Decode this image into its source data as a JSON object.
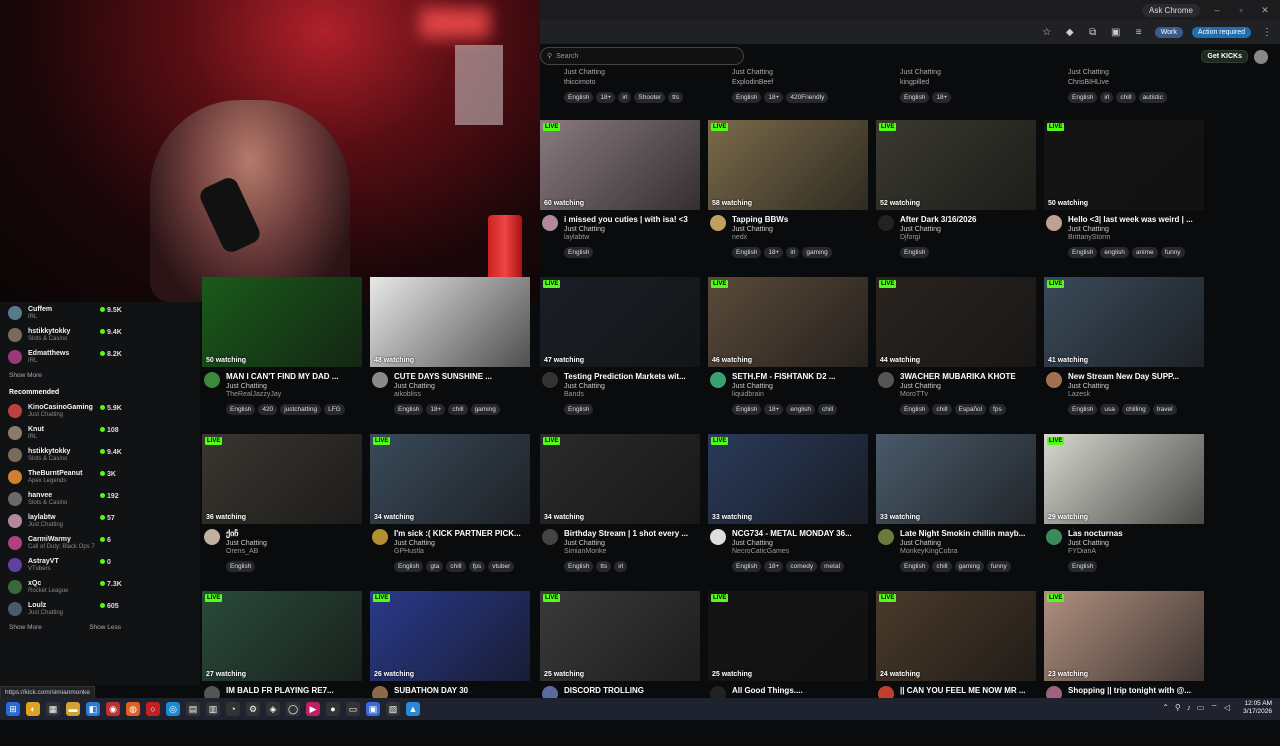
{
  "browser": {
    "ask_chrome": "Ask Chrome",
    "work_label": "Work",
    "action_label": "Action required",
    "search_placeholder": "Search",
    "get_kicks": "Get KICKs",
    "status_url": "https://kick.com/simianmonke"
  },
  "sidebar": {
    "following": [
      {
        "name": "Cuffem",
        "category": "IRL",
        "viewers": "9.5K",
        "color": "#5a7a8a"
      },
      {
        "name": "hstikkytokky",
        "category": "Slots & Casino",
        "viewers": "9.4K",
        "color": "#7a6a5a"
      },
      {
        "name": "Edmatthews",
        "category": "IRL",
        "viewers": "8.2K",
        "color": "#9a3a7a"
      }
    ],
    "show_more_1": "Show More",
    "recommended_title": "Recommended",
    "recommended": [
      {
        "name": "KinoCasinoGaming",
        "category": "Just Chatting",
        "viewers": "5.9K",
        "color": "#c04040"
      },
      {
        "name": "Knut",
        "category": "IRL",
        "viewers": "108",
        "color": "#8a7a6a"
      },
      {
        "name": "hstikkytokky",
        "category": "Slots & Casino",
        "viewers": "9.4K",
        "color": "#7a6a5a"
      },
      {
        "name": "TheBurntPeanut",
        "category": "Apex Legends",
        "viewers": "3K",
        "color": "#d08030"
      },
      {
        "name": "hanvee",
        "category": "Slots & Casino",
        "viewers": "192",
        "color": "#6a6a6a"
      },
      {
        "name": "laylabtw",
        "category": "Just Chatting",
        "viewers": "57",
        "color": "#b08a9a"
      },
      {
        "name": "CarmiWarmy",
        "category": "Call of Duty: Black Ops 7",
        "viewers": "6",
        "color": "#b04080"
      },
      {
        "name": "AstrayVT",
        "category": "VTubers",
        "viewers": "0",
        "color": "#6040a0"
      },
      {
        "name": "xQc",
        "category": "Rocket League",
        "viewers": "7.3K",
        "color": "#3a6a3a"
      },
      {
        "name": "Loulz",
        "category": "Just Chatting",
        "viewers": "605",
        "color": "#4a5a6a"
      }
    ],
    "show_more_2": "Show More",
    "show_less": "Show Less"
  },
  "top_row": [
    {
      "category": "Just Chatting",
      "streamer": "thiccimoto",
      "tags": [
        "English",
        "18+",
        "irl",
        "Shooter",
        "tts"
      ]
    },
    {
      "category": "Just Chatting",
      "streamer": "ExplodinBeef",
      "tags": [
        "English",
        "18+",
        "420Friendly"
      ]
    },
    {
      "category": "Just Chatting",
      "streamer": "kingpilled",
      "tags": [
        "English",
        "18+"
      ]
    },
    {
      "category": "Just Chatting",
      "streamer": "ChrisBIHLive",
      "tags": [
        "English",
        "irl",
        "chill",
        "autistic"
      ]
    }
  ],
  "cards": [
    {
      "live": "LIVE",
      "watching": "60 watching",
      "title": "i missed you cuties | with isa! <3",
      "category": "Just Chatting",
      "streamer": "laylabtw",
      "tags": [
        "English"
      ],
      "thumb": "#8a7a80",
      "avatar": "#b08a9a"
    },
    {
      "live": "LIVE",
      "watching": "58 watching",
      "title": "Tapping BBWs",
      "category": "Just Chatting",
      "streamer": "nedx",
      "tags": [
        "English",
        "18+",
        "irl",
        "gaming"
      ],
      "thumb": "#7a6a4a",
      "avatar": "#c0a060"
    },
    {
      "live": "LIVE",
      "watching": "52 watching",
      "title": "After Dark 3/16/2026",
      "category": "Just Chatting",
      "streamer": "Djforgi",
      "tags": [
        "English"
      ],
      "thumb": "#3a3a30",
      "avatar": "#222"
    },
    {
      "live": "LIVE",
      "watching": "50 watching",
      "title": "Hello <3| last week was weird | ...",
      "category": "Just Chatting",
      "streamer": "BrittanyStorm",
      "tags": [
        "English",
        "english",
        "anime",
        "funny"
      ],
      "thumb": "#141414",
      "avatar": "#c0a090"
    },
    {
      "live": "",
      "watching": "50 watching",
      "title": "MAN I CAN'T FIND MY DAD ...",
      "category": "Just Chatting",
      "streamer": "TheRealJazzyJay",
      "tags": [
        "English",
        "420",
        "justchatting",
        "LFG"
      ],
      "thumb": "#1a5a1a",
      "avatar": "#3a8a3a"
    },
    {
      "live": "",
      "watching": "48 watching",
      "title": "CUTE DAYS SUNSHINE ...",
      "category": "Just Chatting",
      "streamer": "aikobliss",
      "tags": [
        "English",
        "18+",
        "chill",
        "gaming"
      ],
      "thumb": "#e8e8e8",
      "avatar": "#8a8a8a"
    },
    {
      "live": "LIVE",
      "watching": "47 watching",
      "title": "Testing Prediction Markets wit...",
      "category": "Just Chatting",
      "streamer": "Bands",
      "tags": [
        "English"
      ],
      "thumb": "#1a1e26",
      "avatar": "#333"
    },
    {
      "live": "LIVE",
      "watching": "46 watching",
      "title": "SETH.FM - FISHTANK D2 ...",
      "category": "Just Chatting",
      "streamer": "liquidbrain",
      "tags": [
        "English",
        "18+",
        "english",
        "chill"
      ],
      "thumb": "#5a4a3a",
      "avatar": "#3aa070"
    },
    {
      "live": "LIVE",
      "watching": "44 watching",
      "title": "3WACHER MUBARIKA KHOTE",
      "category": "Just Chatting",
      "streamer": "MoroTTv",
      "tags": [
        "English",
        "chill",
        "Español",
        "fps"
      ],
      "thumb": "#2a2420",
      "avatar": "#555"
    },
    {
      "live": "LIVE",
      "watching": "41 watching",
      "title": "New Stream New Day SUPP...",
      "category": "Just Chatting",
      "streamer": "Lazesk",
      "tags": [
        "English",
        "usa",
        "chilling",
        "travel"
      ],
      "thumb": "#3a4a5a",
      "avatar": "#a07050"
    },
    {
      "live": "LIVE",
      "watching": "36 watching",
      "title": "ქიჩ",
      "category": "Just Chatting",
      "streamer": "Orens_AB",
      "tags": [
        "English"
      ],
      "thumb": "#3a3630",
      "avatar": "#c0b0a0"
    },
    {
      "live": "LIVE",
      "watching": "34 watching",
      "title": "I'm sick :( KICK PARTNER PICK...",
      "category": "Just Chatting",
      "streamer": "GPHustla",
      "tags": [
        "English",
        "gta",
        "chill",
        "fps",
        "vtuber"
      ],
      "thumb": "#3a4a5a",
      "avatar": "#b09030"
    },
    {
      "live": "LIVE",
      "watching": "34 watching",
      "title": "Birthday Stream | 1 shot every ...",
      "category": "Just Chatting",
      "streamer": "SimianMonke",
      "tags": [
        "English",
        "tts",
        "irl"
      ],
      "thumb": "#2a2a2a",
      "avatar": "#444"
    },
    {
      "live": "LIVE",
      "watching": "33 watching",
      "title": "NCG734 - METAL MONDAY 36...",
      "category": "Just Chatting",
      "streamer": "NecroCaticGames",
      "tags": [
        "English",
        "18+",
        "comedy",
        "metal"
      ],
      "thumb": "#2a3a5a",
      "avatar": "#ddd"
    },
    {
      "live": "",
      "watching": "33 watching",
      "title": "Late Night Smokin chillin mayb...",
      "category": "Just Chatting",
      "streamer": "MonkeyKingCobra",
      "tags": [
        "English",
        "chill",
        "gaming",
        "funny"
      ],
      "thumb": "#4a5a6a",
      "avatar": "#6a7a3a"
    },
    {
      "live": "LIVE",
      "watching": "29 watching",
      "title": "Las nocturnas",
      "category": "Just Chatting",
      "streamer": "FYDianA",
      "tags": [
        "English"
      ],
      "thumb": "#d8d8d0",
      "avatar": "#3a8a5a"
    },
    {
      "live": "LIVE",
      "watching": "27 watching",
      "title": "IM BALD FR PLAYING RE7...",
      "category": "",
      "streamer": "",
      "tags": [],
      "thumb": "#2a4a3a",
      "avatar": "#555"
    },
    {
      "live": "LIVE",
      "watching": "26 watching",
      "title": "SUBATHON DAY 30",
      "category": "",
      "streamer": "",
      "tags": [],
      "thumb": "#2a3a8a",
      "avatar": "#8a6a4a"
    },
    {
      "live": "LIVE",
      "watching": "25 watching",
      "title": "DISCORD TROLLING",
      "category": "",
      "streamer": "",
      "tags": [],
      "thumb": "#3a3a3a",
      "avatar": "#5a6aa0"
    },
    {
      "live": "LIVE",
      "watching": "25 watching",
      "title": "All Good Things....",
      "category": "",
      "streamer": "",
      "tags": [],
      "thumb": "#141414",
      "avatar": "#222"
    },
    {
      "live": "LIVE",
      "watching": "24 watching",
      "title": "|| CAN YOU FEEL ME NOW MR ...",
      "category": "",
      "streamer": "",
      "tags": [],
      "thumb": "#4a3a2a",
      "avatar": "#c04030"
    },
    {
      "live": "LIVE",
      "watching": "23 watching",
      "title": "Shopping || trip tonight with @...",
      "category": "",
      "streamer": "",
      "tags": [],
      "thumb": "#b09080",
      "avatar": "#a06080"
    }
  ],
  "taskbar": {
    "time": "12:05 AM",
    "date": "3/17/2026"
  }
}
